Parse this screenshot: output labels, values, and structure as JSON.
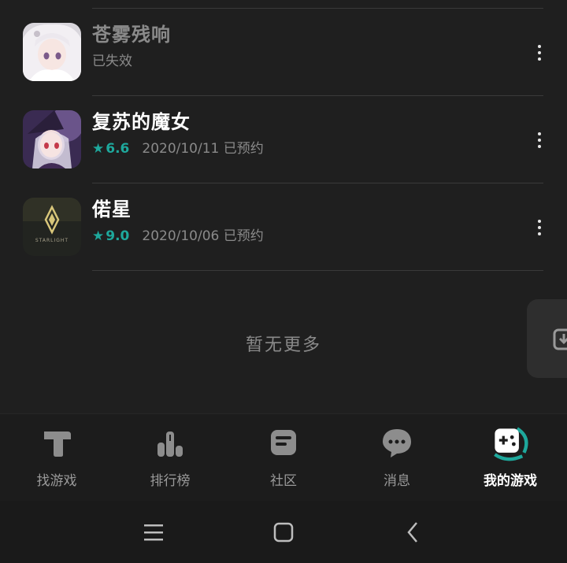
{
  "games": [
    {
      "title": "苍雾残响",
      "status": "已失效",
      "expired": true,
      "icon": "anime-girl-white-hair-icon"
    },
    {
      "title": "复苏的魔女",
      "rating": "6.6",
      "date": "2020/10/11",
      "status": "已预约",
      "icon": "anime-witch-icon"
    },
    {
      "title": "偌星",
      "rating": "9.0",
      "date": "2020/10/06",
      "status": "已预约",
      "icon": "starlight-logo-icon",
      "icon_text": "STARLIGHT"
    }
  ],
  "no_more_text": "暂无更多",
  "tabs": [
    {
      "label": "找游戏",
      "icon": "find-games-icon"
    },
    {
      "label": "排行榜",
      "icon": "ranking-icon"
    },
    {
      "label": "社区",
      "icon": "community-icon"
    },
    {
      "label": "消息",
      "icon": "message-icon"
    },
    {
      "label": "我的游戏",
      "icon": "gamepad-icon",
      "active": true
    }
  ],
  "colors": {
    "accent": "#1ea89c",
    "background": "#1f1f1f",
    "text_muted": "#8a8a8a"
  }
}
